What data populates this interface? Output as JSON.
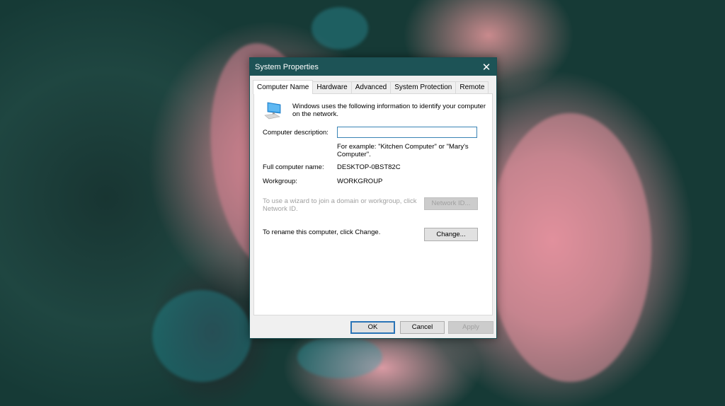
{
  "dialog": {
    "title": "System Properties",
    "close_icon": "close-icon",
    "tabs": [
      {
        "label": "Computer Name",
        "active": true
      },
      {
        "label": "Hardware",
        "active": false
      },
      {
        "label": "Advanced",
        "active": false
      },
      {
        "label": "System Protection",
        "active": false
      },
      {
        "label": "Remote",
        "active": false
      }
    ],
    "intro_icon": "computer-icon",
    "intro_line1": "Windows uses the following information to identify your computer",
    "intro_line2": "on the network.",
    "description_label": "Computer description:",
    "description_value": "",
    "description_placeholder": "",
    "example_line1": "For example: \"Kitchen Computer\" or \"Mary's",
    "example_line2": "Computer\".",
    "full_name_label": "Full computer name:",
    "full_name_value": "DESKTOP-0BST82C",
    "workgroup_label": "Workgroup:",
    "workgroup_value": "WORKGROUP",
    "wizard_line1": "To use a wizard to join a domain or workgroup, click",
    "wizard_line2": "Network ID.",
    "network_id_button": "Network ID...",
    "rename_text": "To rename this computer, click Change.",
    "change_button": "Change...",
    "ok_button": "OK",
    "cancel_button": "Cancel",
    "apply_button": "Apply"
  },
  "colors": {
    "titlebar": "#1d5356",
    "focus_border": "#2a74b7"
  }
}
